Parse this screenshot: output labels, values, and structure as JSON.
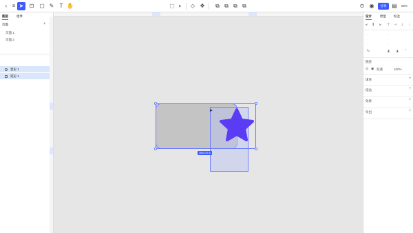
{
  "toolbar": {
    "share_label": "分享",
    "zoom_label": "59%"
  },
  "left_panel": {
    "tabs": [
      "图层",
      "组件"
    ],
    "section_title": "页面",
    "pages": [
      "页面 1",
      "页面 2"
    ],
    "layers": [
      "星形 1",
      "矩形 1"
    ]
  },
  "canvas": {
    "size_badge": "368×215.8",
    "star_color": "#5b3cf5",
    "rect_color": "#c4c4c4",
    "selection_color": "#6b7cff"
  },
  "right_panel": {
    "tabs": [
      "设计",
      "原型",
      "标注"
    ],
    "layer_title": "图层",
    "opacity_label": "穿透",
    "opacity_value": "100%",
    "sections": [
      "填充",
      "描边",
      "效果",
      "导出"
    ]
  },
  "colors": {
    "accent": "#3d5afe",
    "canvas_bg": "#e6e6e6",
    "layer_highlight": "#d9e6fb"
  }
}
